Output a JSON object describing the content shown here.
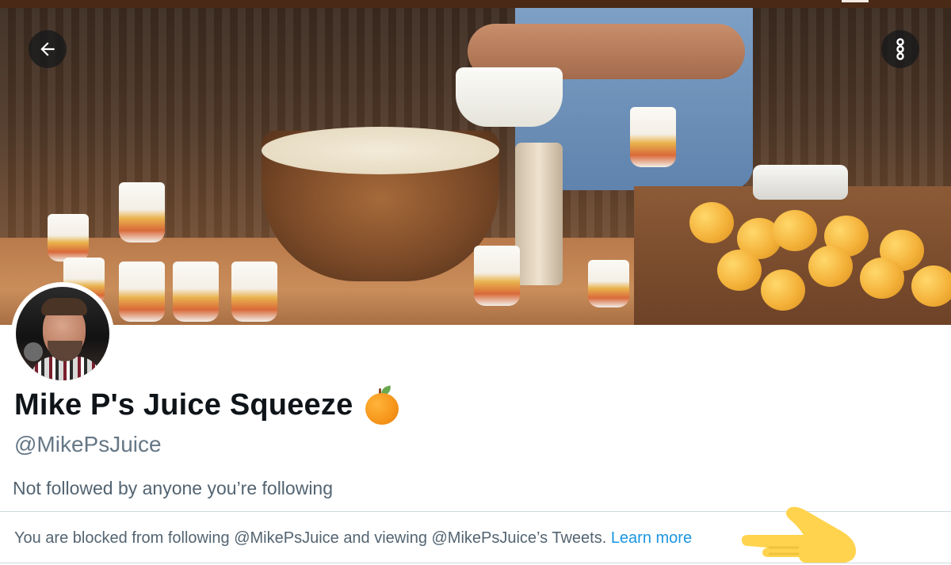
{
  "status_bar": {
    "icons": [
      "status-icon-1",
      "status-icon-2",
      "status-icon-3"
    ]
  },
  "banner": {
    "description_icon": "banner-photo"
  },
  "actions": {
    "back_icon": "arrow-left-icon",
    "more_icon": "vertical-dots-icon"
  },
  "profile": {
    "display_name": "Mike P's Juice Squeeze",
    "name_emoji": "orange-emoji-icon",
    "handle": "@MikePsJuice",
    "followed_by": "Not followed by anyone you’re following"
  },
  "notice": {
    "text": "You are blocked from following @MikePsJuice and viewing @MikePsJuice’s Tweets.",
    "link": "Learn more"
  },
  "colors": {
    "link": "#1b95e0",
    "muted": "#536471",
    "divider": "#cfd9de"
  }
}
